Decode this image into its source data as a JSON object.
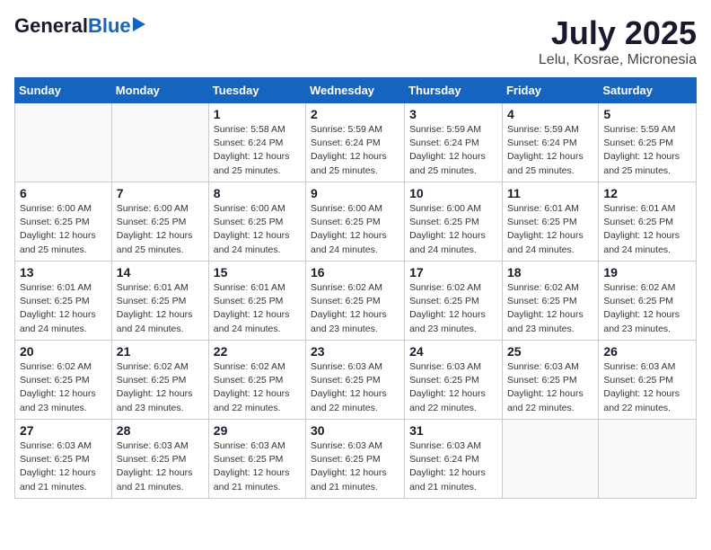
{
  "logo": {
    "general": "General",
    "blue": "Blue"
  },
  "title": "July 2025",
  "subtitle": "Lelu, Kosrae, Micronesia",
  "days_of_week": [
    "Sunday",
    "Monday",
    "Tuesday",
    "Wednesday",
    "Thursday",
    "Friday",
    "Saturday"
  ],
  "weeks": [
    [
      {
        "day": "",
        "info": ""
      },
      {
        "day": "",
        "info": ""
      },
      {
        "day": "1",
        "info": "Sunrise: 5:58 AM\nSunset: 6:24 PM\nDaylight: 12 hours and 25 minutes."
      },
      {
        "day": "2",
        "info": "Sunrise: 5:59 AM\nSunset: 6:24 PM\nDaylight: 12 hours and 25 minutes."
      },
      {
        "day": "3",
        "info": "Sunrise: 5:59 AM\nSunset: 6:24 PM\nDaylight: 12 hours and 25 minutes."
      },
      {
        "day": "4",
        "info": "Sunrise: 5:59 AM\nSunset: 6:24 PM\nDaylight: 12 hours and 25 minutes."
      },
      {
        "day": "5",
        "info": "Sunrise: 5:59 AM\nSunset: 6:25 PM\nDaylight: 12 hours and 25 minutes."
      }
    ],
    [
      {
        "day": "6",
        "info": "Sunrise: 6:00 AM\nSunset: 6:25 PM\nDaylight: 12 hours and 25 minutes."
      },
      {
        "day": "7",
        "info": "Sunrise: 6:00 AM\nSunset: 6:25 PM\nDaylight: 12 hours and 25 minutes."
      },
      {
        "day": "8",
        "info": "Sunrise: 6:00 AM\nSunset: 6:25 PM\nDaylight: 12 hours and 24 minutes."
      },
      {
        "day": "9",
        "info": "Sunrise: 6:00 AM\nSunset: 6:25 PM\nDaylight: 12 hours and 24 minutes."
      },
      {
        "day": "10",
        "info": "Sunrise: 6:00 AM\nSunset: 6:25 PM\nDaylight: 12 hours and 24 minutes."
      },
      {
        "day": "11",
        "info": "Sunrise: 6:01 AM\nSunset: 6:25 PM\nDaylight: 12 hours and 24 minutes."
      },
      {
        "day": "12",
        "info": "Sunrise: 6:01 AM\nSunset: 6:25 PM\nDaylight: 12 hours and 24 minutes."
      }
    ],
    [
      {
        "day": "13",
        "info": "Sunrise: 6:01 AM\nSunset: 6:25 PM\nDaylight: 12 hours and 24 minutes."
      },
      {
        "day": "14",
        "info": "Sunrise: 6:01 AM\nSunset: 6:25 PM\nDaylight: 12 hours and 24 minutes."
      },
      {
        "day": "15",
        "info": "Sunrise: 6:01 AM\nSunset: 6:25 PM\nDaylight: 12 hours and 24 minutes."
      },
      {
        "day": "16",
        "info": "Sunrise: 6:02 AM\nSunset: 6:25 PM\nDaylight: 12 hours and 23 minutes."
      },
      {
        "day": "17",
        "info": "Sunrise: 6:02 AM\nSunset: 6:25 PM\nDaylight: 12 hours and 23 minutes."
      },
      {
        "day": "18",
        "info": "Sunrise: 6:02 AM\nSunset: 6:25 PM\nDaylight: 12 hours and 23 minutes."
      },
      {
        "day": "19",
        "info": "Sunrise: 6:02 AM\nSunset: 6:25 PM\nDaylight: 12 hours and 23 minutes."
      }
    ],
    [
      {
        "day": "20",
        "info": "Sunrise: 6:02 AM\nSunset: 6:25 PM\nDaylight: 12 hours and 23 minutes."
      },
      {
        "day": "21",
        "info": "Sunrise: 6:02 AM\nSunset: 6:25 PM\nDaylight: 12 hours and 23 minutes."
      },
      {
        "day": "22",
        "info": "Sunrise: 6:02 AM\nSunset: 6:25 PM\nDaylight: 12 hours and 22 minutes."
      },
      {
        "day": "23",
        "info": "Sunrise: 6:03 AM\nSunset: 6:25 PM\nDaylight: 12 hours and 22 minutes."
      },
      {
        "day": "24",
        "info": "Sunrise: 6:03 AM\nSunset: 6:25 PM\nDaylight: 12 hours and 22 minutes."
      },
      {
        "day": "25",
        "info": "Sunrise: 6:03 AM\nSunset: 6:25 PM\nDaylight: 12 hours and 22 minutes."
      },
      {
        "day": "26",
        "info": "Sunrise: 6:03 AM\nSunset: 6:25 PM\nDaylight: 12 hours and 22 minutes."
      }
    ],
    [
      {
        "day": "27",
        "info": "Sunrise: 6:03 AM\nSunset: 6:25 PM\nDaylight: 12 hours and 21 minutes."
      },
      {
        "day": "28",
        "info": "Sunrise: 6:03 AM\nSunset: 6:25 PM\nDaylight: 12 hours and 21 minutes."
      },
      {
        "day": "29",
        "info": "Sunrise: 6:03 AM\nSunset: 6:25 PM\nDaylight: 12 hours and 21 minutes."
      },
      {
        "day": "30",
        "info": "Sunrise: 6:03 AM\nSunset: 6:25 PM\nDaylight: 12 hours and 21 minutes."
      },
      {
        "day": "31",
        "info": "Sunrise: 6:03 AM\nSunset: 6:24 PM\nDaylight: 12 hours and 21 minutes."
      },
      {
        "day": "",
        "info": ""
      },
      {
        "day": "",
        "info": ""
      }
    ]
  ]
}
